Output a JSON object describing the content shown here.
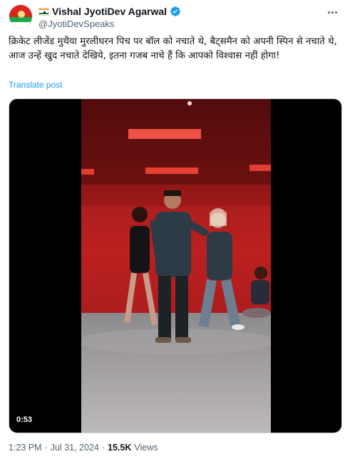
{
  "author": {
    "display_name": "Vishal JyotiDev Agarwal",
    "handle": "@JyotiDevSpeaks",
    "verified": true
  },
  "tweet": {
    "line1": "क्रिकेट लीजेंड मुथैया मुरलीधरन पिच पर बॉल को नचाते थे, बैट्समैन को अपनी स्पिन से नचाते थे,",
    "line2": "आज उन्हें खुद नचाते देखिये, इतना गजब नाचे हैं कि आपको विश्वास नहीं होगा!",
    "translate_label": "Translate post"
  },
  "media": {
    "duration": "0:53"
  },
  "meta": {
    "time": "1:23 PM",
    "separator": "·",
    "date": "Jul 31, 2024",
    "views_count": "15.5K",
    "views_label": "Views"
  },
  "colors": {
    "link": "#1d9bf0",
    "verified": "#1d9bf0",
    "secondary_text": "#536471"
  },
  "icons": [
    "india-flag-icon",
    "verified-badge-icon",
    "more-options-icon"
  ]
}
